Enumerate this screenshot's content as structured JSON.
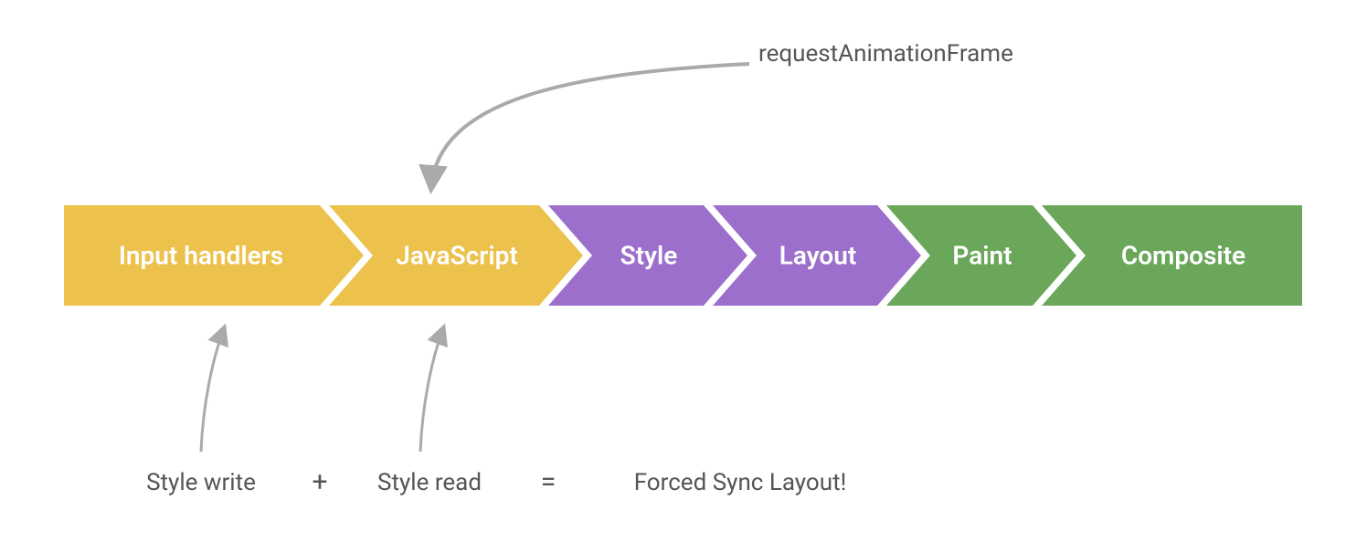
{
  "diagram": {
    "top_annotation": "requestAnimationFrame",
    "stages": [
      {
        "id": "input-handlers",
        "label": "Input handlers",
        "color": "#ECC14C"
      },
      {
        "id": "javascript",
        "label": "JavaScript",
        "color": "#ECC14C"
      },
      {
        "id": "style",
        "label": "Style",
        "color": "#9B6FCB"
      },
      {
        "id": "layout",
        "label": "Layout",
        "color": "#9B6FCB"
      },
      {
        "id": "paint",
        "label": "Paint",
        "color": "#6AA75A"
      },
      {
        "id": "composite",
        "label": "Composite",
        "color": "#6AA75A"
      }
    ],
    "bottom_equation": {
      "left": "Style write",
      "op1": "+",
      "middle": "Style read",
      "op2": "=",
      "right": "Forced Sync Layout!"
    }
  }
}
